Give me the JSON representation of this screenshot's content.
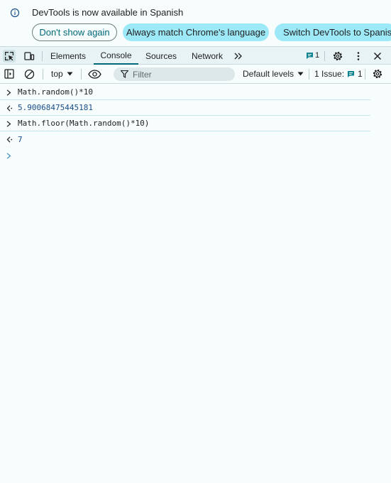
{
  "infobar": {
    "message": "DevTools is now available in Spanish",
    "dont_show": "Don't show again",
    "always_match": "Always match Chrome's language",
    "switch": "Switch DevTools to Spanish"
  },
  "tabs": {
    "elements": "Elements",
    "console": "Console",
    "sources": "Sources",
    "network": "Network",
    "message_count": "1"
  },
  "console_toolbar": {
    "context": "top",
    "filter_placeholder": "Filter",
    "levels": "Default levels",
    "issues_label": "1 Issue:",
    "issues_count": "1"
  },
  "console_entries": [
    {
      "type": "input",
      "text": "Math.random()*10"
    },
    {
      "type": "output",
      "text": "5.90068475445181"
    },
    {
      "type": "input",
      "text": "Math.floor(Math.random()*10)"
    },
    {
      "type": "output",
      "text": "7"
    }
  ],
  "colors": {
    "accent": "#00687a",
    "chip": "#9de9f7",
    "background": "#f7fcfd"
  }
}
